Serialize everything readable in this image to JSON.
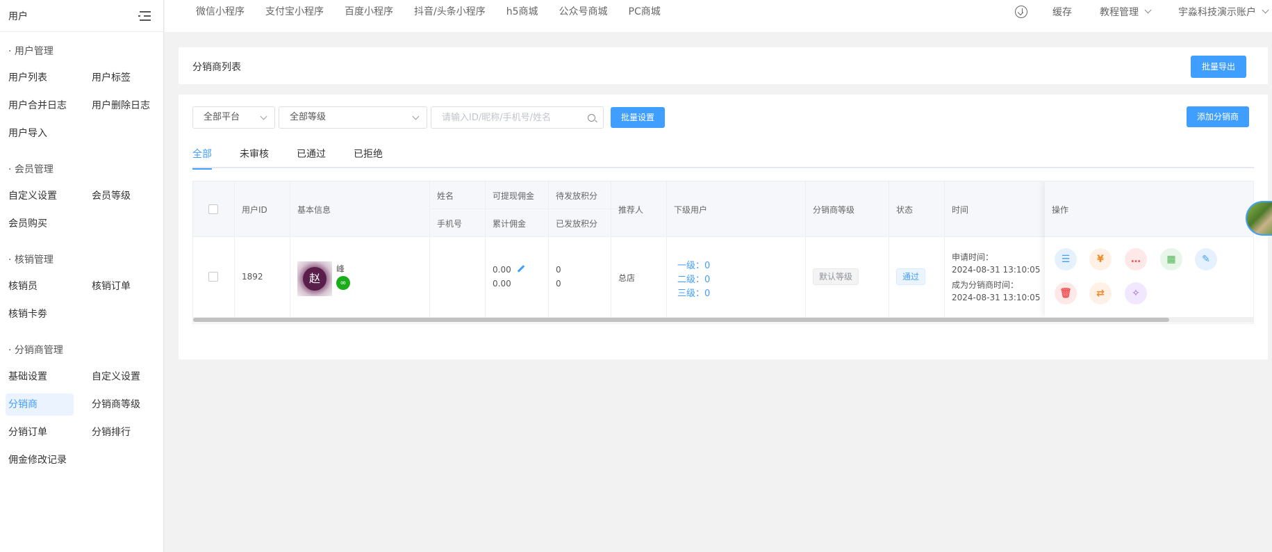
{
  "sidebar": {
    "title": "用户",
    "groups": [
      {
        "title": "· 用户管理",
        "items": [
          "用户列表",
          "用户标签",
          "用户合并日志",
          "用户删除日志",
          "用户导入"
        ]
      },
      {
        "title": "· 会员管理",
        "items": [
          "自定义设置",
          "会员等级",
          "会员购买"
        ]
      },
      {
        "title": "· 核销管理",
        "items": [
          "核销员",
          "核销订单",
          "核销卡劵"
        ]
      },
      {
        "title": "· 分销商管理",
        "items": [
          "基础设置",
          "自定义设置",
          "分销商",
          "分销商等级",
          "分销订单",
          "分销排行",
          "佣金修改记录"
        ]
      }
    ],
    "active_item": "分销商"
  },
  "topnav": {
    "links": [
      "微信小程序",
      "支付宝小程序",
      "百度小程序",
      "抖音/头条小程序",
      "h5商城",
      "公众号商城",
      "PC商城"
    ],
    "cache": "缓存",
    "tutorial": "教程管理",
    "account": "宇淼科技演示账户"
  },
  "header_card": {
    "title": "分销商列表",
    "export_label": "批量导出"
  },
  "filters": {
    "platform": "全部平台",
    "level": "全部等级",
    "search_placeholder": "请输入ID/昵称/手机号/姓名",
    "batch_label": "批量设置",
    "add_label": "添加分销商"
  },
  "tabs": [
    "全部",
    "未审核",
    "已通过",
    "已拒绝"
  ],
  "table": {
    "headers": {
      "user_id": "用户ID",
      "basic_info": "基本信息",
      "name": "姓名",
      "phone": "手机号",
      "withdrawable": "可提现佣金",
      "total_commission": "累计佣金",
      "pending_points": "待发放积分",
      "issued_points": "已发放积分",
      "referrer": "推荐人",
      "subordinates": "下级用户",
      "level": "分销商等级",
      "status": "状态",
      "time": "时间",
      "ops": "操作"
    },
    "rows": [
      {
        "user_id": "1892",
        "avatar_char": "赵",
        "nickname": "峰",
        "withdrawable": "0.00",
        "total_commission": "0.00",
        "pending_points": "0",
        "issued_points": "0",
        "referrer": "总店",
        "level1": "一级：0",
        "level2": "二级：0",
        "level3": "三级：0",
        "level": "默认等级",
        "status": "通过",
        "apply_label": "申请时间：",
        "apply_time": "2024-08-31 13:10:05",
        "become_label": "成为分销商时间：",
        "become_time": "2024-08-31 13:10:05"
      }
    ]
  },
  "op_icons": [
    "order-icon",
    "commission-icon",
    "message-icon",
    "qrcode-icon",
    "edit-icon",
    "delete-icon",
    "unbind-icon",
    "settings-icon"
  ],
  "colors": {
    "primary": "#409eff",
    "wechat": "#1aad19"
  }
}
